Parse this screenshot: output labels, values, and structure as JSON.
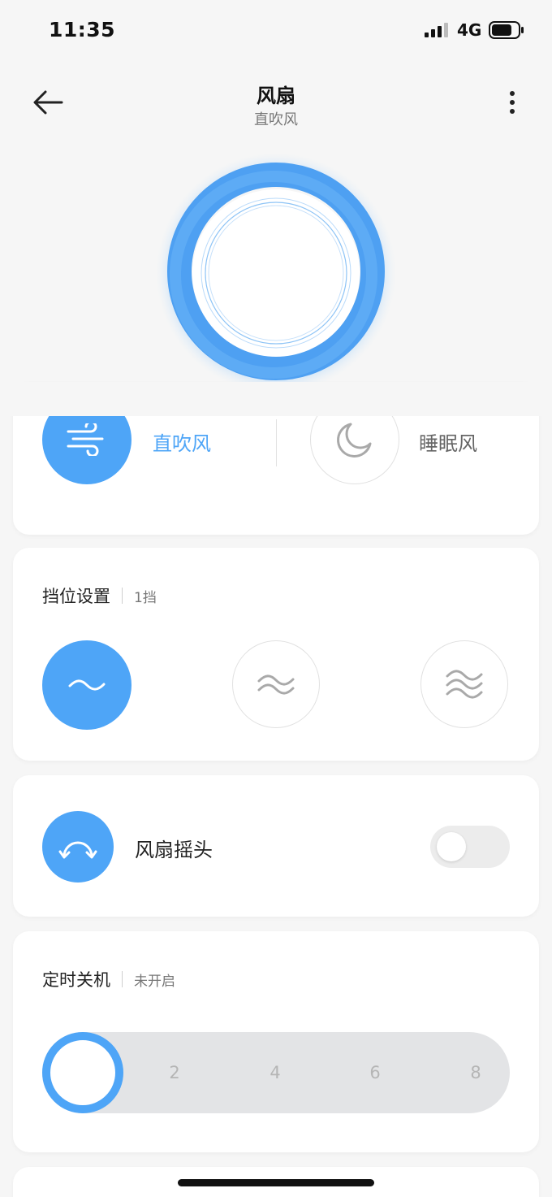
{
  "status_bar": {
    "time": "11:35",
    "network": "4G"
  },
  "header": {
    "title": "风扇",
    "subtitle": "直吹风"
  },
  "modes": [
    {
      "label": "直吹风",
      "icon": "wind-icon",
      "active": true
    },
    {
      "label": "睡眠风",
      "icon": "moon-icon",
      "active": false
    }
  ],
  "speed": {
    "title": "挡位设置",
    "value": "1挡",
    "levels": [
      {
        "icon": "wave-1-icon",
        "active": true
      },
      {
        "icon": "wave-2-icon",
        "active": false
      },
      {
        "icon": "wave-3-icon",
        "active": false
      }
    ]
  },
  "swing": {
    "label": "风扇摇头",
    "icon": "swing-arc-icon",
    "enabled": false
  },
  "timer": {
    "title": "定时关机",
    "value": "未开启",
    "ticks": [
      "2",
      "4",
      "6",
      "8"
    ],
    "selected_fraction": 0
  },
  "colors": {
    "accent": "#4ea5f7",
    "background": "#f6f6f6",
    "card": "#ffffff"
  }
}
